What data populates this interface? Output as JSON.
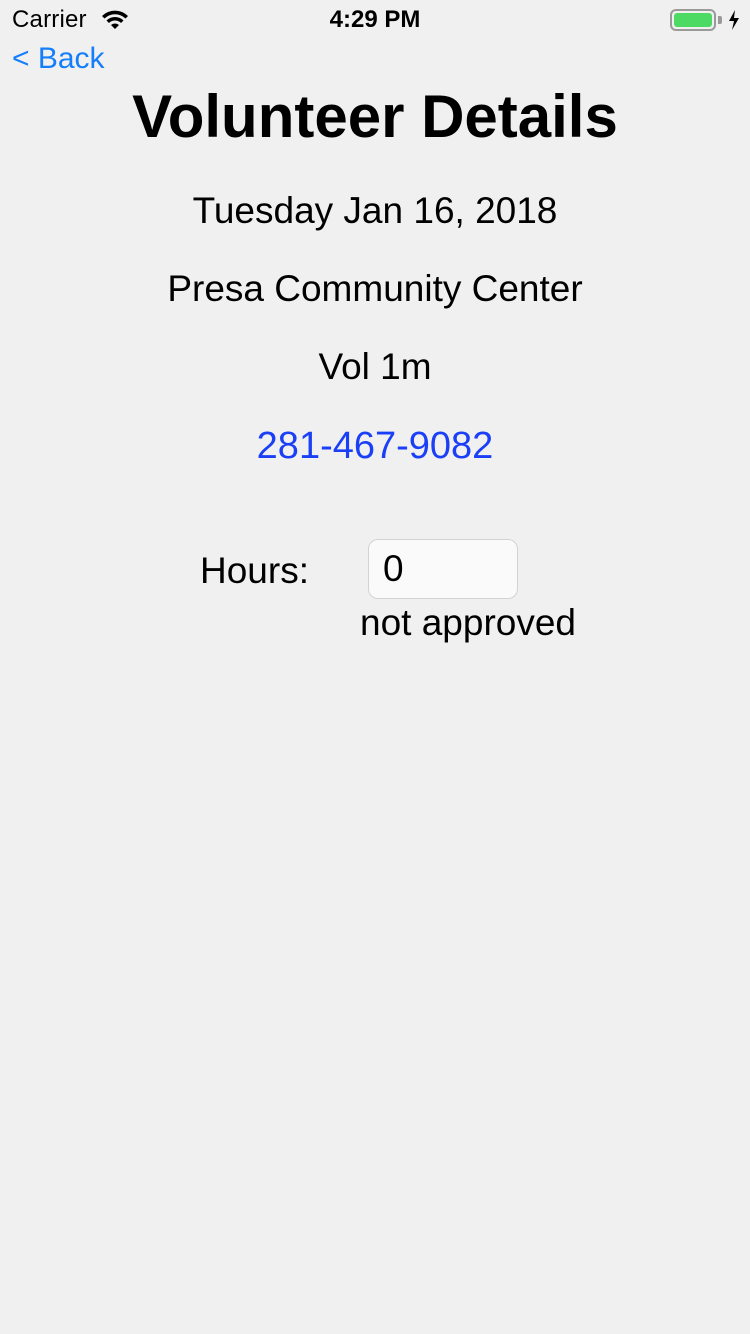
{
  "status_bar": {
    "carrier": "Carrier",
    "time": "4:29 PM",
    "battery_level": 1.0,
    "battery_color": "#4cd964"
  },
  "nav": {
    "back_label": "< Back"
  },
  "details": {
    "title": "Volunteer Details",
    "date": "Tuesday Jan 16, 2018",
    "location": "Presa Community Center",
    "volunteer": "Vol 1m",
    "phone": "281-467-9082"
  },
  "hours": {
    "label": "Hours:",
    "value": "0",
    "status": "not approved"
  },
  "colors": {
    "link": "#147efb",
    "phone": "#1a3ff7",
    "background": "#f0f0f0"
  }
}
